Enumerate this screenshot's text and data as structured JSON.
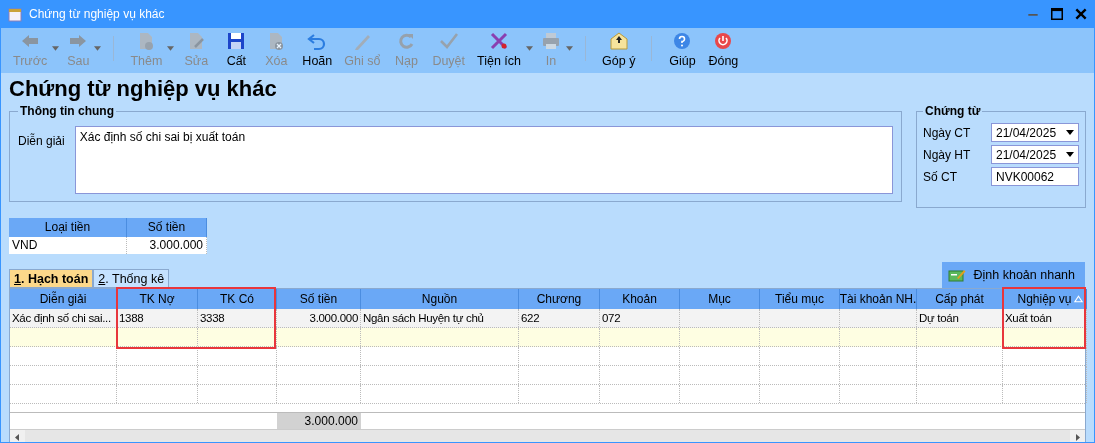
{
  "window": {
    "title": "Chứng từ nghiệp vụ khác"
  },
  "toolbar": [
    {
      "label": "Trước",
      "kind": "back",
      "disabled": true,
      "dropdown": true,
      "separator_after": false
    },
    {
      "label": "Sau",
      "kind": "forward",
      "disabled": true,
      "dropdown": true,
      "separator_after": true
    },
    {
      "label": "Thêm",
      "kind": "add",
      "disabled": true,
      "dropdown": true,
      "separator_after": false
    },
    {
      "label": "Sửa",
      "kind": "edit",
      "disabled": true,
      "dropdown": false,
      "separator_after": false
    },
    {
      "label": "Cất",
      "kind": "save",
      "disabled": false,
      "dropdown": false,
      "separator_after": false
    },
    {
      "label": "Xóa",
      "kind": "delete",
      "disabled": true,
      "dropdown": false,
      "separator_after": false
    },
    {
      "label": "Hoãn",
      "kind": "undo",
      "disabled": false,
      "dropdown": false,
      "separator_after": false
    },
    {
      "label": "Ghi sổ",
      "kind": "post",
      "disabled": true,
      "dropdown": false,
      "separator_after": false
    },
    {
      "label": "Nạp",
      "kind": "reload",
      "disabled": true,
      "dropdown": false,
      "separator_after": false
    },
    {
      "label": "Duyệt",
      "kind": "approve",
      "disabled": true,
      "dropdown": false,
      "separator_after": false
    },
    {
      "label": "Tiện ích",
      "kind": "tools",
      "disabled": false,
      "dropdown": true,
      "separator_after": false
    },
    {
      "label": "In",
      "kind": "print",
      "disabled": true,
      "dropdown": true,
      "separator_after": true
    },
    {
      "label": "Góp ý",
      "kind": "feedback",
      "disabled": false,
      "dropdown": false,
      "separator_after": true
    },
    {
      "label": "Giúp",
      "kind": "help",
      "disabled": false,
      "dropdown": false,
      "separator_after": false
    },
    {
      "label": "Đóng",
      "kind": "close",
      "disabled": false,
      "dropdown": false,
      "separator_after": false
    }
  ],
  "heading": "Chứng từ nghiệp vụ khác",
  "general": {
    "title": "Thông tin chung",
    "description_label": "Diễn giải",
    "description": "Xác định số chi sai bị xuất toán"
  },
  "voucher": {
    "title": "Chứng từ",
    "fields": [
      {
        "label": "Ngày CT",
        "value": "21/04/2025",
        "kind": "date"
      },
      {
        "label": "Ngày HT",
        "value": "21/04/2025",
        "kind": "date"
      },
      {
        "label": "Số CT",
        "value": "NVK00062",
        "kind": "text"
      }
    ]
  },
  "currency": {
    "columns": [
      "Loại tiền",
      "Số tiền"
    ],
    "rows": [
      [
        "VND",
        "3.000.000"
      ]
    ]
  },
  "tabs": [
    {
      "label": "1. Hạch toán",
      "selected": true
    },
    {
      "label": "2. Thống kê",
      "selected": false
    }
  ],
  "quick_button": "Định khoản nhanh",
  "grid": {
    "columns": [
      {
        "label": "Diễn giải",
        "kind": "text",
        "sorted": false,
        "highlighted": false
      },
      {
        "label": "TK Nợ",
        "kind": "text",
        "sorted": false,
        "highlighted": true
      },
      {
        "label": "TK Có",
        "kind": "text",
        "sorted": false,
        "highlighted": true
      },
      {
        "label": "Số tiền",
        "kind": "amount",
        "sorted": false,
        "highlighted": false,
        "total": "3.000.000"
      },
      {
        "label": "Nguồn",
        "kind": "text",
        "sorted": false,
        "highlighted": false
      },
      {
        "label": "Chương",
        "kind": "text",
        "sorted": false,
        "highlighted": false
      },
      {
        "label": "Khoản",
        "kind": "text",
        "sorted": false,
        "highlighted": false
      },
      {
        "label": "Mục",
        "kind": "text",
        "sorted": false,
        "highlighted": false
      },
      {
        "label": "Tiểu mục",
        "kind": "text",
        "sorted": false,
        "highlighted": false
      },
      {
        "label": "Tài khoản NH.",
        "kind": "text",
        "sorted": false,
        "highlighted": false
      },
      {
        "label": "Cấp phát",
        "kind": "text",
        "sorted": false,
        "highlighted": false
      },
      {
        "label": "Nghiệp vụ",
        "kind": "text",
        "sorted": true,
        "highlighted": true
      }
    ],
    "rows": [
      [
        "Xác định số chi sai...",
        "1388",
        "3338",
        "3.000.000",
        "Ngân sách Huyện tự chủ",
        "622",
        "072",
        "",
        "",
        "",
        "Dự toán",
        "Xuất toán"
      ]
    ]
  }
}
